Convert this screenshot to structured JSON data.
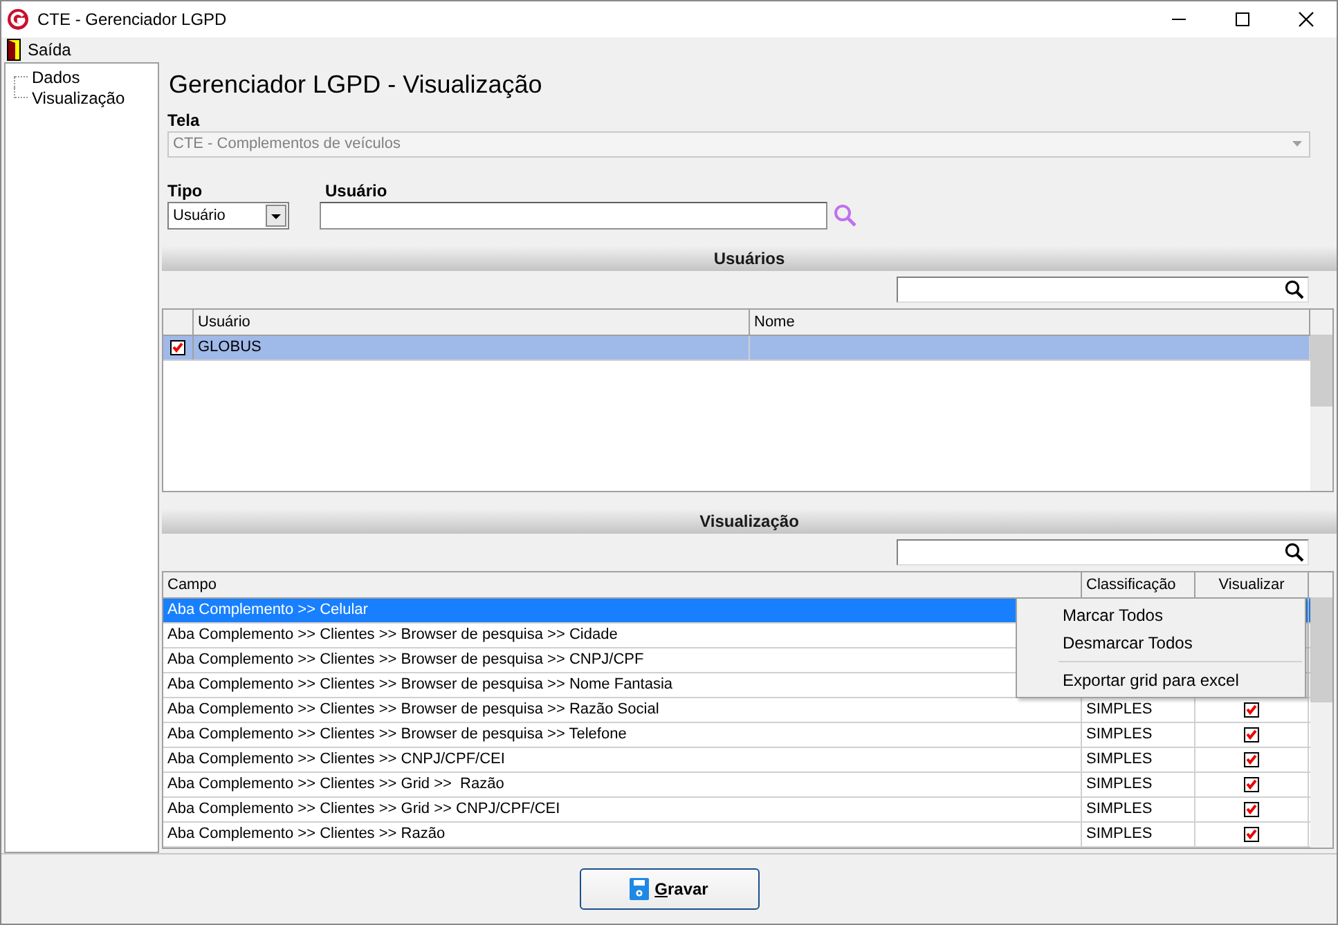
{
  "window": {
    "title": "CTE - Gerenciador LGPD"
  },
  "menu": [
    {
      "label": "Saída"
    }
  ],
  "tree": [
    {
      "label": "Dados"
    },
    {
      "label": "Visualização"
    }
  ],
  "heading": "Gerenciador LGPD - Visualização",
  "tela": {
    "label": "Tela",
    "value": "CTE - Complementos de veículos",
    "disabled": true
  },
  "tipo": {
    "label": "Tipo",
    "value": "Usuário"
  },
  "usuario": {
    "label": "Usuário"
  },
  "usuarios": {
    "title": "Usuários",
    "columns": [
      "Usuário",
      "Nome"
    ],
    "rows": [
      {
        "usuario": "GLOBUS",
        "checked": true,
        "selected": true
      }
    ]
  },
  "visualizacao": {
    "title": "Visualização",
    "columns": [
      "Campo",
      "Classificação",
      "Visualizar"
    ],
    "rows": [
      {
        "campo": "Aba Complemento >> Celular",
        "selected": true
      },
      {
        "campo": "Aba Complemento >> Clientes >> Browser de pesquisa >> Cidade",
        "selected": false
      },
      {
        "campo": "Aba Complemento >> Clientes >> Browser de pesquisa >> CNPJ/CPF",
        "selected": false
      },
      {
        "campo": "Aba Complemento >> Clientes >> Browser de pesquisa >> Nome Fantasia",
        "selected": false
      },
      {
        "campo": "Aba Complemento >> Clientes >> Browser de pesquisa >> Razão Social",
        "classificacao": "SIMPLES",
        "checked": true,
        "selected": false
      },
      {
        "campo": "Aba Complemento >> Clientes >> Browser de pesquisa >> Telefone",
        "classificacao": "SIMPLES",
        "checked": true,
        "selected": false
      },
      {
        "campo": "Aba Complemento >> Clientes >> CNPJ/CPF/CEI",
        "classificacao": "SIMPLES",
        "checked": true,
        "selected": false
      },
      {
        "campo": "Aba Complemento >> Clientes >> Grid >>  Razão",
        "classificacao": "SIMPLES",
        "checked": true,
        "selected": false
      },
      {
        "campo": "Aba Complemento >> Clientes >> Grid >> CNPJ/CPF/CEI",
        "classificacao": "SIMPLES",
        "checked": true,
        "selected": false
      },
      {
        "campo": "Aba Complemento >> Clientes >> Razão",
        "classificacao": "SIMPLES",
        "checked": true,
        "selected": false
      }
    ]
  },
  "context_menu": [
    {
      "kind": "item",
      "label": "Marcar Todos"
    },
    {
      "kind": "item",
      "label": "Desmarcar Todos"
    },
    {
      "kind": "separator"
    },
    {
      "kind": "item",
      "label": "Exportar grid para excel"
    }
  ],
  "buttons": [
    {
      "label": "Gravar"
    }
  ]
}
